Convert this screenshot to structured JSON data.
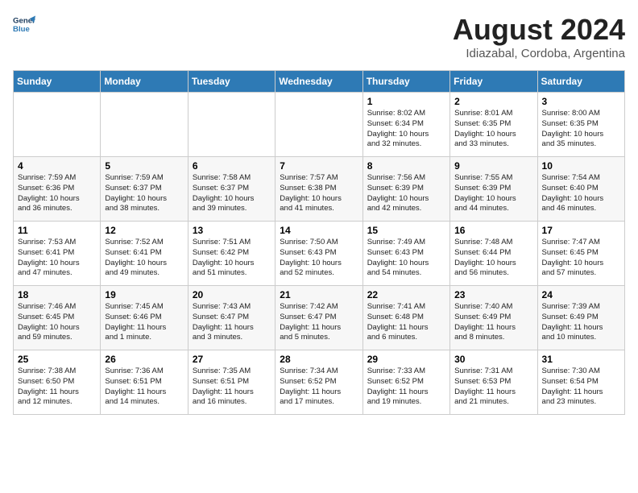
{
  "header": {
    "logo_line1": "General",
    "logo_line2": "Blue",
    "title": "August 2024",
    "subtitle": "Idiazabal, Cordoba, Argentina"
  },
  "days_of_week": [
    "Sunday",
    "Monday",
    "Tuesday",
    "Wednesday",
    "Thursday",
    "Friday",
    "Saturday"
  ],
  "weeks": [
    [
      {
        "day": "",
        "detail": ""
      },
      {
        "day": "",
        "detail": ""
      },
      {
        "day": "",
        "detail": ""
      },
      {
        "day": "",
        "detail": ""
      },
      {
        "day": "1",
        "detail": "Sunrise: 8:02 AM\nSunset: 6:34 PM\nDaylight: 10 hours\nand 32 minutes."
      },
      {
        "day": "2",
        "detail": "Sunrise: 8:01 AM\nSunset: 6:35 PM\nDaylight: 10 hours\nand 33 minutes."
      },
      {
        "day": "3",
        "detail": "Sunrise: 8:00 AM\nSunset: 6:35 PM\nDaylight: 10 hours\nand 35 minutes."
      }
    ],
    [
      {
        "day": "4",
        "detail": "Sunrise: 7:59 AM\nSunset: 6:36 PM\nDaylight: 10 hours\nand 36 minutes."
      },
      {
        "day": "5",
        "detail": "Sunrise: 7:59 AM\nSunset: 6:37 PM\nDaylight: 10 hours\nand 38 minutes."
      },
      {
        "day": "6",
        "detail": "Sunrise: 7:58 AM\nSunset: 6:37 PM\nDaylight: 10 hours\nand 39 minutes."
      },
      {
        "day": "7",
        "detail": "Sunrise: 7:57 AM\nSunset: 6:38 PM\nDaylight: 10 hours\nand 41 minutes."
      },
      {
        "day": "8",
        "detail": "Sunrise: 7:56 AM\nSunset: 6:39 PM\nDaylight: 10 hours\nand 42 minutes."
      },
      {
        "day": "9",
        "detail": "Sunrise: 7:55 AM\nSunset: 6:39 PM\nDaylight: 10 hours\nand 44 minutes."
      },
      {
        "day": "10",
        "detail": "Sunrise: 7:54 AM\nSunset: 6:40 PM\nDaylight: 10 hours\nand 46 minutes."
      }
    ],
    [
      {
        "day": "11",
        "detail": "Sunrise: 7:53 AM\nSunset: 6:41 PM\nDaylight: 10 hours\nand 47 minutes."
      },
      {
        "day": "12",
        "detail": "Sunrise: 7:52 AM\nSunset: 6:41 PM\nDaylight: 10 hours\nand 49 minutes."
      },
      {
        "day": "13",
        "detail": "Sunrise: 7:51 AM\nSunset: 6:42 PM\nDaylight: 10 hours\nand 51 minutes."
      },
      {
        "day": "14",
        "detail": "Sunrise: 7:50 AM\nSunset: 6:43 PM\nDaylight: 10 hours\nand 52 minutes."
      },
      {
        "day": "15",
        "detail": "Sunrise: 7:49 AM\nSunset: 6:43 PM\nDaylight: 10 hours\nand 54 minutes."
      },
      {
        "day": "16",
        "detail": "Sunrise: 7:48 AM\nSunset: 6:44 PM\nDaylight: 10 hours\nand 56 minutes."
      },
      {
        "day": "17",
        "detail": "Sunrise: 7:47 AM\nSunset: 6:45 PM\nDaylight: 10 hours\nand 57 minutes."
      }
    ],
    [
      {
        "day": "18",
        "detail": "Sunrise: 7:46 AM\nSunset: 6:45 PM\nDaylight: 10 hours\nand 59 minutes."
      },
      {
        "day": "19",
        "detail": "Sunrise: 7:45 AM\nSunset: 6:46 PM\nDaylight: 11 hours\nand 1 minute."
      },
      {
        "day": "20",
        "detail": "Sunrise: 7:43 AM\nSunset: 6:47 PM\nDaylight: 11 hours\nand 3 minutes."
      },
      {
        "day": "21",
        "detail": "Sunrise: 7:42 AM\nSunset: 6:47 PM\nDaylight: 11 hours\nand 5 minutes."
      },
      {
        "day": "22",
        "detail": "Sunrise: 7:41 AM\nSunset: 6:48 PM\nDaylight: 11 hours\nand 6 minutes."
      },
      {
        "day": "23",
        "detail": "Sunrise: 7:40 AM\nSunset: 6:49 PM\nDaylight: 11 hours\nand 8 minutes."
      },
      {
        "day": "24",
        "detail": "Sunrise: 7:39 AM\nSunset: 6:49 PM\nDaylight: 11 hours\nand 10 minutes."
      }
    ],
    [
      {
        "day": "25",
        "detail": "Sunrise: 7:38 AM\nSunset: 6:50 PM\nDaylight: 11 hours\nand 12 minutes."
      },
      {
        "day": "26",
        "detail": "Sunrise: 7:36 AM\nSunset: 6:51 PM\nDaylight: 11 hours\nand 14 minutes."
      },
      {
        "day": "27",
        "detail": "Sunrise: 7:35 AM\nSunset: 6:51 PM\nDaylight: 11 hours\nand 16 minutes."
      },
      {
        "day": "28",
        "detail": "Sunrise: 7:34 AM\nSunset: 6:52 PM\nDaylight: 11 hours\nand 17 minutes."
      },
      {
        "day": "29",
        "detail": "Sunrise: 7:33 AM\nSunset: 6:52 PM\nDaylight: 11 hours\nand 19 minutes."
      },
      {
        "day": "30",
        "detail": "Sunrise: 7:31 AM\nSunset: 6:53 PM\nDaylight: 11 hours\nand 21 minutes."
      },
      {
        "day": "31",
        "detail": "Sunrise: 7:30 AM\nSunset: 6:54 PM\nDaylight: 11 hours\nand 23 minutes."
      }
    ]
  ]
}
